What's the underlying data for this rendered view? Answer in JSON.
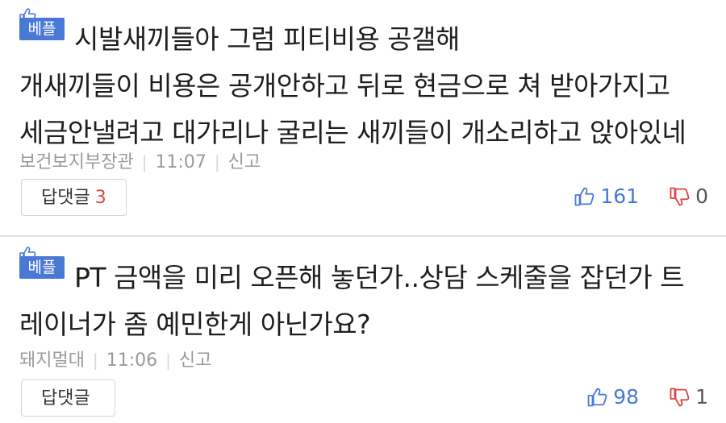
{
  "comments": [
    {
      "badge": "베플",
      "lines": [
        "시발새끼들아 그럼 피티비용 공갤해",
        "개새끼들이 비용은 공개안하고 뒤로 현금으로 쳐 받아가지고",
        "세금안낼려고 대가리나 굴리는 새끼들이 개소리하고 앉아있네"
      ],
      "author": "보건보지부장관",
      "time": "11:07",
      "report": "신고",
      "reply_label": "답댓글",
      "reply_count": "3",
      "likes": "161",
      "dislikes": "0"
    },
    {
      "badge": "베플",
      "lines": [
        "PT 금액을 미리 오픈해 놓던가..상담 스케줄을 잡던가 트",
        "레이너가 좀 예민한게 아닌가요?"
      ],
      "author": "돼지멀대",
      "time": "11:06",
      "report": "신고",
      "reply_label": "답댓글",
      "reply_count": "",
      "likes": "98",
      "dislikes": "1"
    }
  ],
  "colors": {
    "badge": "#4a79d5",
    "like": "#4a79d5",
    "dislike": "#e0433f",
    "reply_count": "#e0433f"
  },
  "icons": {
    "badge_icon": "thumbs-up-icon",
    "like_icon": "thumbs-up-icon",
    "dislike_icon": "thumbs-down-icon"
  }
}
